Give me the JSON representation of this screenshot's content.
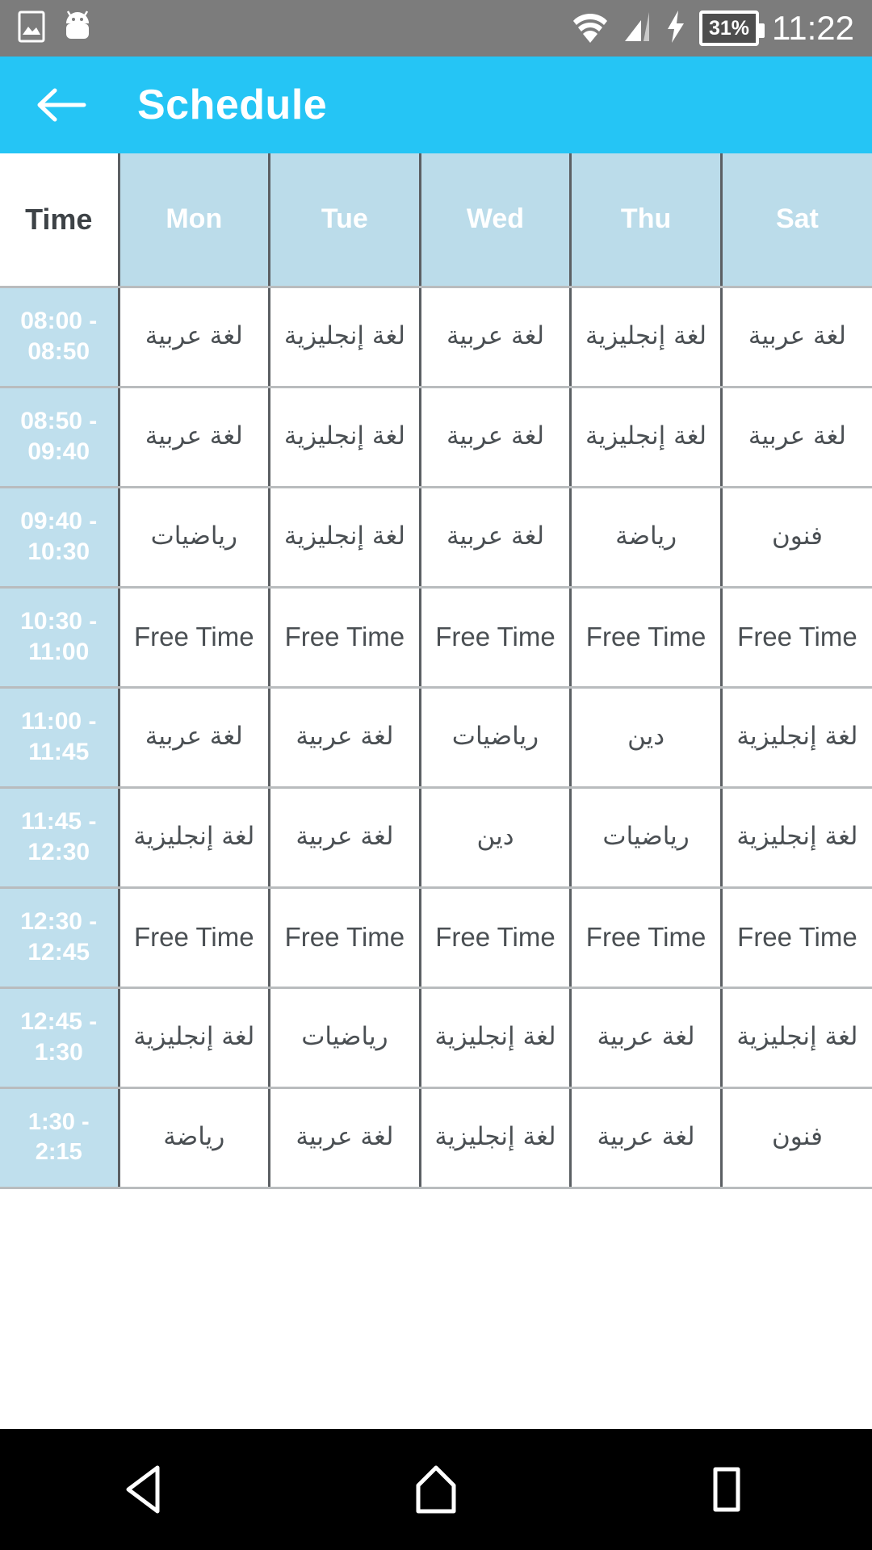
{
  "statusbar": {
    "time": "11:22",
    "battery_percent": "31%",
    "icons": [
      "image-icon",
      "android-robot-icon",
      "wifi-icon",
      "cellular-signal-icon",
      "charging-bolt-icon",
      "battery-icon"
    ]
  },
  "appbar": {
    "title": "Schedule",
    "back_label": "Back",
    "background": "#25c5f5"
  },
  "table": {
    "columns": [
      "Time",
      "Mon",
      "Tue",
      "Wed",
      "Thu",
      "Sat"
    ],
    "header_time_bg": "#ffffff",
    "header_day_bg": "#bbdcea",
    "time_cell_bg": "#bfdfed",
    "rows": [
      {
        "time": "08:00 - 08:50",
        "cells": [
          "لغة عربية",
          "لغة إنجليزية",
          "لغة عربية",
          "لغة إنجليزية",
          "لغة عربية"
        ]
      },
      {
        "time": "08:50 - 09:40",
        "cells": [
          "لغة عربية",
          "لغة إنجليزية",
          "لغة عربية",
          "لغة إنجليزية",
          "لغة عربية"
        ]
      },
      {
        "time": "09:40 - 10:30",
        "cells": [
          "رياضيات",
          "لغة إنجليزية",
          "لغة عربية",
          "رياضة",
          "فنون"
        ]
      },
      {
        "time": "10:30 - 11:00",
        "cells": [
          "Free Time",
          "Free Time",
          "Free Time",
          "Free Time",
          "Free Time"
        ]
      },
      {
        "time": "11:00 - 11:45",
        "cells": [
          "لغة عربية",
          "لغة عربية",
          "رياضيات",
          "دين",
          "لغة إنجليزية"
        ]
      },
      {
        "time": "11:45 - 12:30",
        "cells": [
          "لغة إنجليزية",
          "لغة عربية",
          "دين",
          "رياضيات",
          "لغة إنجليزية"
        ]
      },
      {
        "time": "12:30 - 12:45",
        "cells": [
          "Free Time",
          "Free Time",
          "Free Time",
          "Free Time",
          "Free Time"
        ]
      },
      {
        "time": "12:45 - 1:30",
        "cells": [
          "لغة إنجليزية",
          "رياضيات",
          "لغة إنجليزية",
          "لغة عربية",
          "لغة إنجليزية"
        ]
      },
      {
        "time": "1:30 - 2:15",
        "cells": [
          "رياضة",
          "لغة عربية",
          "لغة إنجليزية",
          "لغة عربية",
          "فنون"
        ]
      }
    ]
  },
  "navbar": {
    "back": "back-nav",
    "home": "home-nav",
    "recents": "recents-nav"
  }
}
